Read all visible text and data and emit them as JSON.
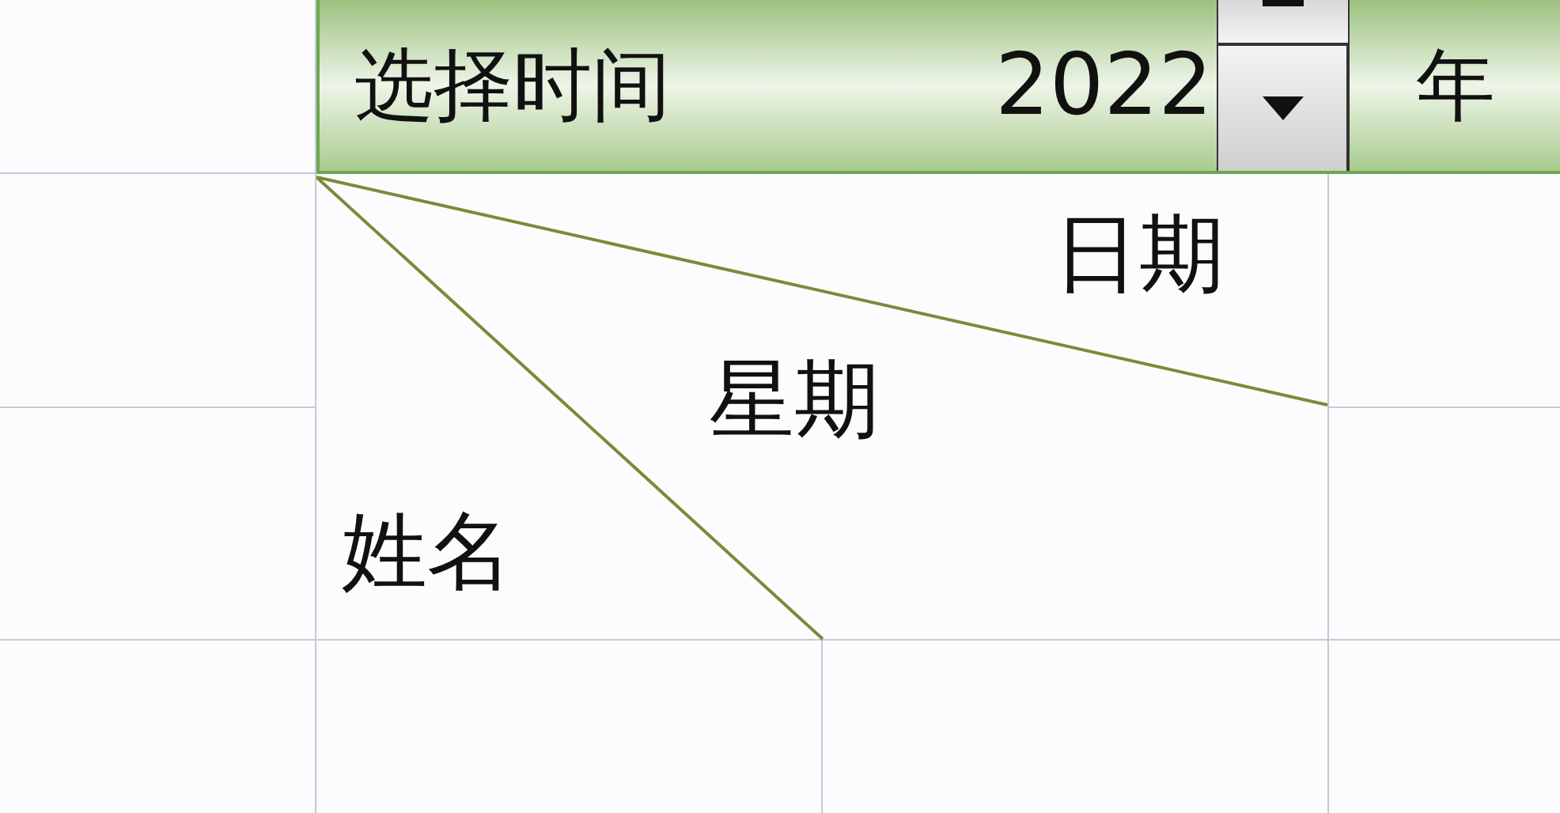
{
  "header": {
    "label": "选择时间",
    "year": "2022",
    "year_unit": "年"
  },
  "diagonal_header": {
    "top_label": "日期",
    "middle_label": "星期",
    "bottom_label": "姓名"
  }
}
